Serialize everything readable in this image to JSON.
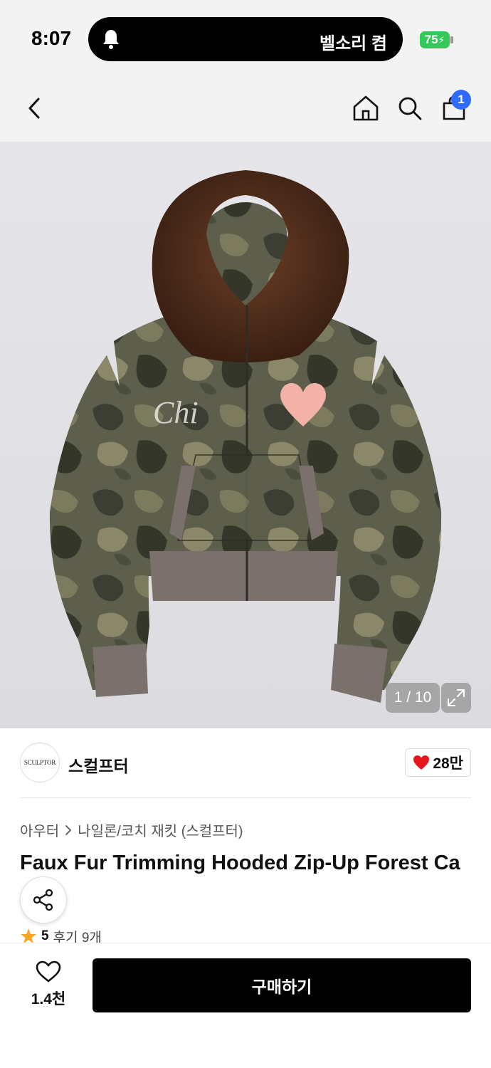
{
  "status_bar": {
    "time": "8:07",
    "island_text": "벨소리 켬",
    "battery": "75"
  },
  "nav": {
    "cart_count": "1"
  },
  "product_image": {
    "counter": "1 / 10",
    "print_text": "Chi",
    "colors": {
      "camo_base": "#5d5e4c",
      "fur": "#5a3320",
      "heart": "#f2b2a8",
      "rib": "#7a716d"
    }
  },
  "brand": {
    "logo_text": "SCULPTOR",
    "name": "스컬프터",
    "likes": "28만"
  },
  "breadcrumb": {
    "category": "아우터",
    "subcategory": "나일론/코치 재킷 (스컬프터)"
  },
  "product": {
    "title": "Faux Fur Trimming Hooded Zip-Up Forest Ca",
    "rating": "5",
    "reviews": "후기 9개"
  },
  "bottom_bar": {
    "wish_count": "1.4천",
    "buy_label": "구매하기"
  },
  "theme": {
    "accent": "#2f6bff",
    "heart": "#e8141c",
    "star": "#f5a623",
    "battery": "#34c759"
  }
}
